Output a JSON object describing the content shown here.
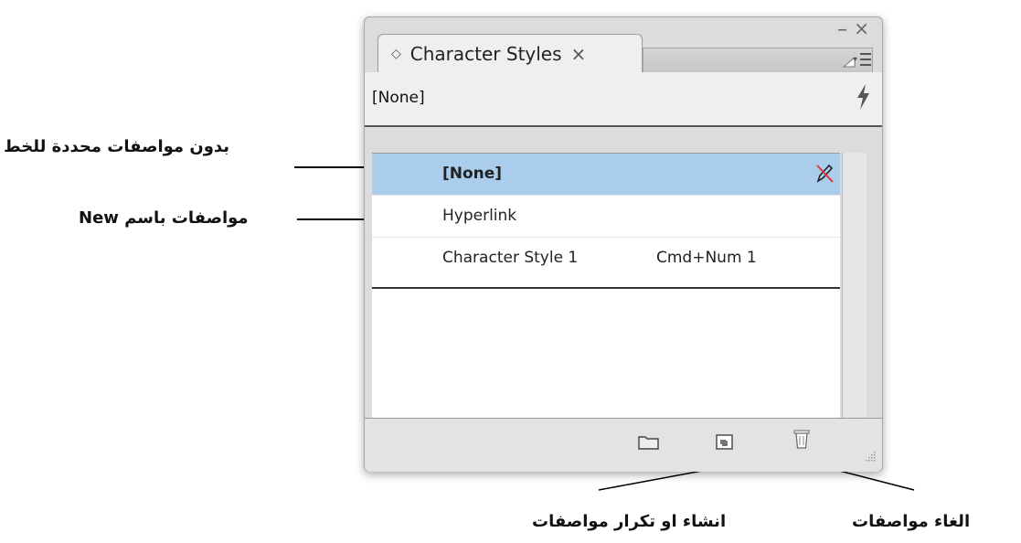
{
  "panel": {
    "tab": {
      "icon": "stepper-arrows-icon",
      "label": "Character Styles",
      "close": "×"
    },
    "window_controls": {
      "minimize": "–",
      "close": "×",
      "menu": "panel-menu-icon"
    },
    "current_style": "[None]",
    "list": [
      {
        "label": "[None]",
        "shortcut": "",
        "selected": true,
        "icon": "no-delete-pencil-icon"
      },
      {
        "label": "Hyperlink",
        "shortcut": "",
        "selected": false
      },
      {
        "label": "Character Style 1",
        "shortcut": "Cmd+Num 1",
        "selected": false
      }
    ],
    "footer_buttons": [
      "folder-icon",
      "new-style-icon",
      "trash-icon"
    ],
    "colors": {
      "selection": "#a9cdea",
      "panel_bg": "#dcdcdc"
    }
  },
  "annotations": {
    "none_style": "بدون مواصفات محددة للخط",
    "new_style": "مواصفات باسم New",
    "create_duplicate": "انشاء او تكرار مواصفات",
    "delete": "الغاء مواصفات"
  }
}
